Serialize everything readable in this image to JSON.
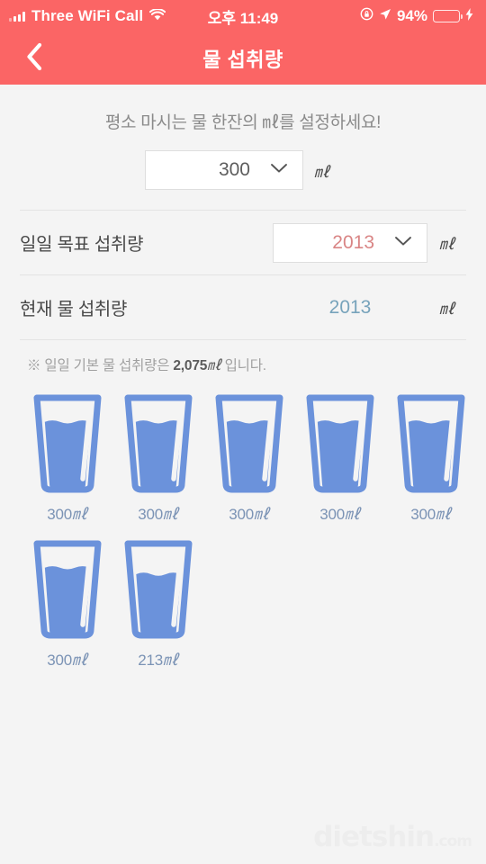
{
  "statusbar": {
    "carrier": "Three WiFi Call",
    "time": "오후 11:49",
    "battery_percent": "94%",
    "icons": [
      "signal-bars-icon",
      "wifi-icon",
      "rotation-lock-icon",
      "location-arrow-icon",
      "battery-icon",
      "charging-bolt-icon"
    ]
  },
  "header": {
    "title": "물 섭취량",
    "back_icon": "chevron-left-icon",
    "background_color": "#fb6565"
  },
  "main": {
    "prompt": "평소 마시는 물 한잔의 ㎖를 설정하세요!",
    "cup_size": {
      "value": "300",
      "unit": "㎖",
      "chevron_icon": "chevron-down-icon"
    },
    "rows": [
      {
        "label": "일일 목표 섭취량",
        "value": "2013",
        "unit": "㎖",
        "type": "select",
        "value_color": "#d98585",
        "chevron_icon": "chevron-down-icon"
      },
      {
        "label": "현재 물 섭취량",
        "value": "2013",
        "unit": "㎖",
        "type": "readonly",
        "value_color": "#77a3bb"
      }
    ],
    "note": {
      "prefix": "※ 일일 기본 물 섭취량은 ",
      "amount": "2,075",
      "unit": "㎖",
      "suffix": " 입니다."
    },
    "glasses": [
      {
        "label": "300",
        "unit": "㎖",
        "fill": 0.78
      },
      {
        "label": "300",
        "unit": "㎖",
        "fill": 0.78
      },
      {
        "label": "300",
        "unit": "㎖",
        "fill": 0.78
      },
      {
        "label": "300",
        "unit": "㎖",
        "fill": 0.78
      },
      {
        "label": "300",
        "unit": "㎖",
        "fill": 0.78
      },
      {
        "label": "300",
        "unit": "㎖",
        "fill": 0.78
      },
      {
        "label": "213",
        "unit": "㎖",
        "fill": 0.7
      }
    ],
    "glass_color": "#6b92db",
    "background_color": "#f4f4f4"
  },
  "watermark": {
    "name": "dietshin",
    "domain": ".com"
  }
}
